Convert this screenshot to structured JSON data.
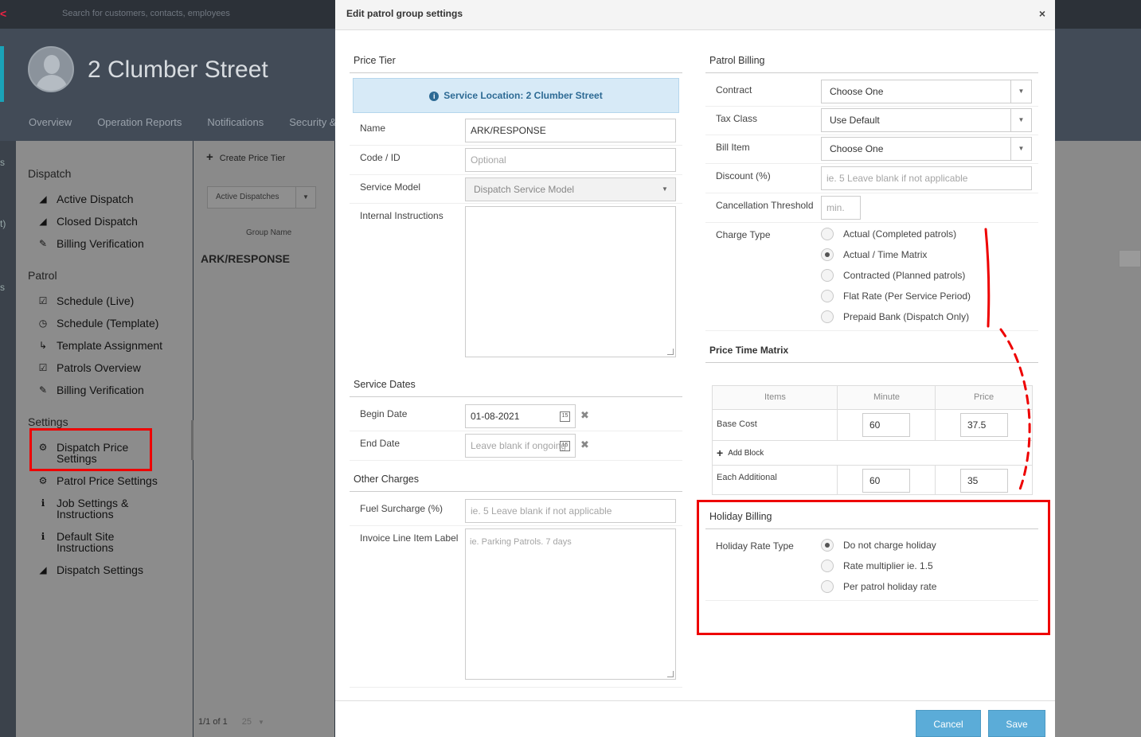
{
  "topbar": {
    "search_placeholder": "Search for customers, contacts, employees"
  },
  "site": {
    "title": "2 Clumber Street",
    "tabs": [
      "Overview",
      "Operation Reports",
      "Notifications",
      "Security &"
    ]
  },
  "sidenav": {
    "dispatch_group": "Dispatch",
    "dispatch_items": [
      "Active Dispatch",
      "Closed Dispatch",
      "Billing Verification"
    ],
    "patrol_group": "Patrol",
    "patrol_items": [
      "Schedule (Live)",
      "Schedule (Template)",
      "Template Assignment",
      "Patrols Overview",
      "Billing Verification"
    ],
    "settings_group": "Settings",
    "settings_items": [
      "Dispatch Price Settings",
      "Patrol Price Settings",
      "Job Settings & Instructions",
      "Default Site Instructions",
      "Dispatch Settings"
    ],
    "edge_fragments": [
      "s",
      "t)",
      "s"
    ]
  },
  "content": {
    "create_label": "Create Price Tier",
    "filter_value": "Active Dispatches",
    "column_header": "Group Name",
    "group_row": "ARK/RESPONSE",
    "pager_text": "1/1 of 1",
    "page_size": "25"
  },
  "modal": {
    "title": "Edit patrol group settings",
    "close_symbol": "×",
    "price_tier": {
      "title": "Price Tier",
      "info": "Service Location: 2 Clumber Street",
      "name_label": "Name",
      "name_value": "ARK/RESPONSE",
      "code_label": "Code / ID",
      "code_placeholder": "Optional",
      "model_label": "Service Model",
      "model_value": "Dispatch Service Model",
      "instructions_label": "Internal Instructions"
    },
    "service_dates": {
      "title": "Service Dates",
      "begin_label": "Begin Date",
      "begin_value": "01-08-2021",
      "end_label": "End Date",
      "end_placeholder": "Leave blank if ongoing"
    },
    "other_charges": {
      "title": "Other Charges",
      "fuel_label": "Fuel Surcharge (%)",
      "fuel_placeholder": "ie. 5  Leave blank if not applicable",
      "invoice_label": "Invoice Line Item Label",
      "invoice_placeholder": "ie. Parking Patrols. 7 days"
    },
    "patrol_billing": {
      "title": "Patrol Billing",
      "contract_label": "Contract",
      "contract_value": "Choose One",
      "tax_label": "Tax Class",
      "tax_value": "Use Default",
      "bill_label": "Bill Item",
      "bill_value": "Choose One",
      "discount_label": "Discount (%)",
      "discount_placeholder": "ie. 5  Leave blank if not applicable",
      "cancel_label": "Cancellation Threshold",
      "cancel_placeholder": "min.",
      "charge_label": "Charge Type",
      "charge_options": [
        "Actual (Completed patrols)",
        "Actual / Time Matrix",
        "Contracted (Planned patrols)",
        "Flat Rate (Per Service Period)",
        "Prepaid Bank (Dispatch Only)"
      ],
      "charge_selected": 1
    },
    "matrix": {
      "title": "Price Time Matrix",
      "headers": [
        "Items",
        "Minute",
        "Price"
      ],
      "base_label": "Base Cost",
      "base_minute": "60",
      "base_price": "37.5",
      "add_block": "Add Block",
      "each_label": "Each Additional",
      "each_minute": "60",
      "each_price": "35"
    },
    "holiday": {
      "title": "Holiday Billing",
      "rate_label": "Holiday Rate Type",
      "options": [
        "Do not charge holiday",
        "Rate multiplier ie. 1.5",
        "Per patrol holiday rate"
      ],
      "selected": 0
    },
    "cancel_button": "Cancel",
    "save_button": "Save"
  },
  "colors": {
    "highlight": "#ee0000",
    "button": "#5bacd8",
    "info_bg": "#d7eaf7",
    "info_text": "#2d6a94"
  }
}
